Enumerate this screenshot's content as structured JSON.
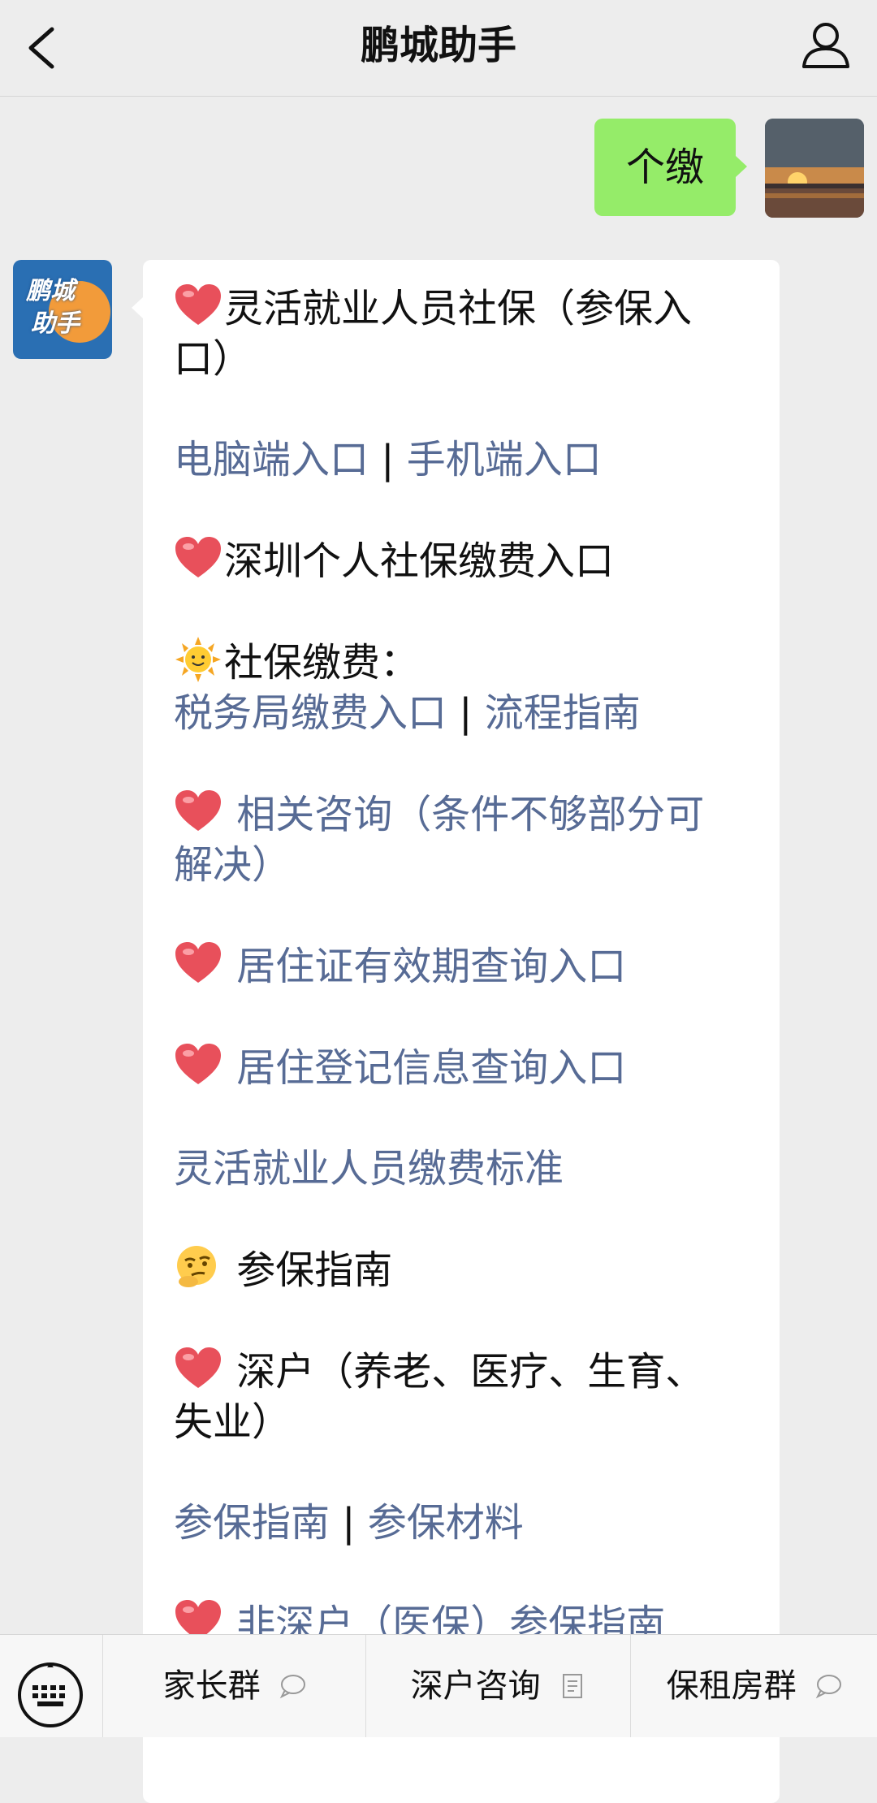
{
  "header": {
    "title": "鹏城助手"
  },
  "outgoing_message": {
    "text": "个缴"
  },
  "bot_avatar": {
    "line1": "鹏城",
    "line2": "助手"
  },
  "incoming_message": {
    "l01": "灵活就业人员社保（参保入",
    "l02": "口）",
    "l03a": "电脑端入口",
    "sep": " | ",
    "l03b": "手机端入口",
    "l04": "深圳个人社保缴费入口",
    "l05": "社保缴费：",
    "l06a": "税务局缴费入口",
    "l06b": "流程指南",
    "l07": " 相关咨询（条件不够部分可",
    "l08": "解决）",
    "l09": " 居住证有效期查询入口",
    "l10": " 居住登记信息查询入口",
    "l11": "灵活就业人员缴费标准",
    "l12": " 参保指南",
    "l13": " 深户（养老、医疗、生育、",
    "l14": "失业）",
    "l15a": "参保指南",
    "l15b": "参保材料",
    "l16": " 非深户（医保）参保指南"
  },
  "bottom_menu": {
    "item1": "家长群",
    "item2": "深户咨询",
    "item3": "保租房群"
  },
  "icons": {
    "back": "chevron-left-icon",
    "profile": "user-icon",
    "heart": "heart-emoji",
    "sun": "sun-emoji",
    "thinking": "thinking-emoji",
    "keyboard": "keyboard-icon",
    "chat": "chat-bubble-icon",
    "doc": "document-icon"
  },
  "colors": {
    "background": "#ededed",
    "outgoing_bubble": "#95ec69",
    "link": "#576b95"
  }
}
